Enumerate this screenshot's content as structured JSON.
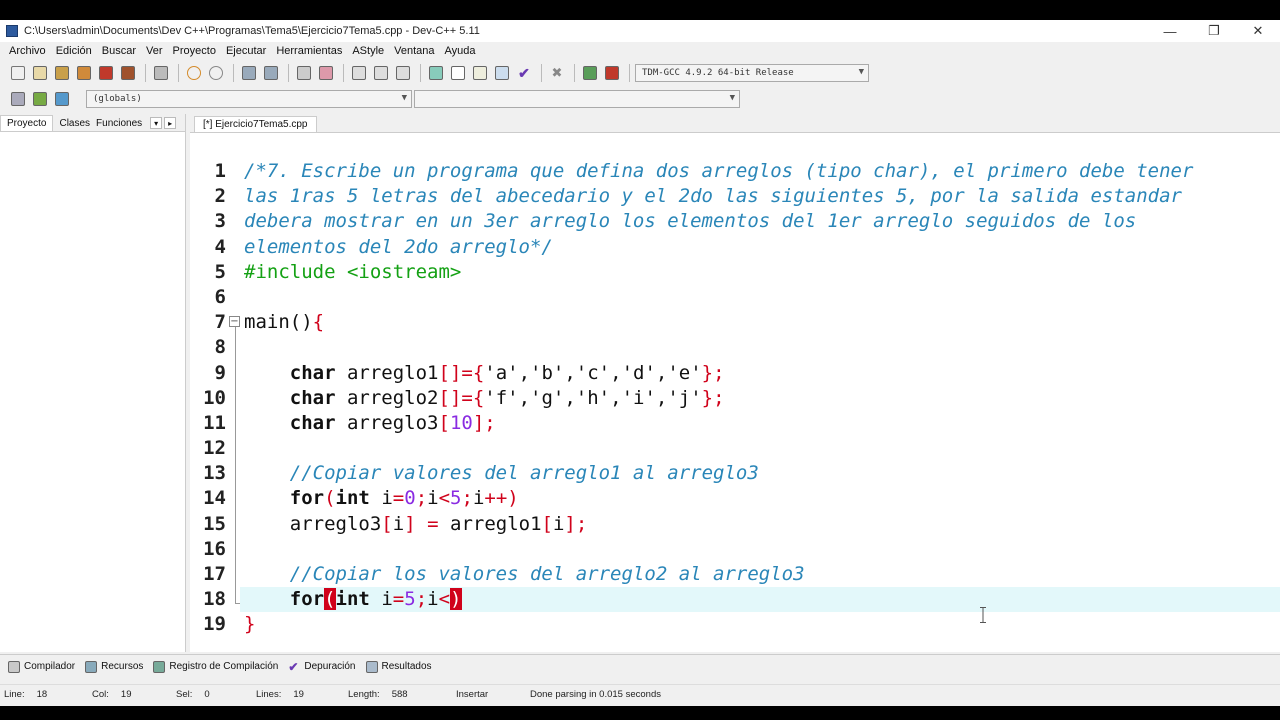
{
  "window": {
    "title": "C:\\Users\\admin\\Documents\\Dev C++\\Programas\\Tema5\\Ejercicio7Tema5.cpp - Dev-C++ 5.11",
    "controls": [
      "—",
      "❐",
      "✕"
    ]
  },
  "menu": [
    "Archivo",
    "Edición",
    "Buscar",
    "Ver",
    "Proyecto",
    "Ejecutar",
    "Herramientas",
    "AStyle",
    "Ventana",
    "Ayuda"
  ],
  "toolbar": {
    "compiler_select": "TDM-GCC 4.9.2 64-bit Release",
    "scope_select": "(globals)",
    "member_select": ""
  },
  "left_panel": {
    "tabs": [
      "Proyecto",
      "Clases",
      "Funciones"
    ],
    "controls": [
      "▾",
      "▸"
    ]
  },
  "editor": {
    "tab_label": "[*] Ejercicio7Tema5.cpp"
  },
  "code": {
    "line_numbers": [
      "1",
      "2",
      "3",
      "4",
      "5",
      "6",
      "7",
      "8",
      "9",
      "10",
      "11",
      "12",
      "13",
      "14",
      "15",
      "16",
      "17",
      "18",
      "19"
    ],
    "line1": "/*7. Escribe un programa que defina dos arreglos (tipo char), el primero debe tener",
    "line2": "las 1ras 5 letras del abecedario y el 2do las siguientes 5, por la salida estandar",
    "line3": "debera mostrar en un 3er arreglo los elementos del 1er arreglo seguidos de los",
    "line4": "elementos del 2do arreglo*/",
    "line5": "#include <iostream>",
    "line7_name": "main()",
    "line7_brace": "{",
    "kw_char": "char",
    "arreglo1": "arreglo1",
    "arreglo2": "arreglo2",
    "arreglo3": "arreglo3",
    "line9_init": "'a','b','c','d','e'",
    "line10_init": "'f','g','h','i','j'",
    "line11_size": "10",
    "line13": "//Copiar valores del arreglo1 al arreglo3",
    "line14_for": "for",
    "line14_int": "int",
    "line14_rest": "i",
    "line17": "//Copiar los valores del arreglo2 al arreglo3",
    "line18_init": "5",
    "line19": "}"
  },
  "bottom_tabs": [
    "Compilador",
    "Recursos",
    "Registro de Compilación",
    "Depuración",
    "Resultados"
  ],
  "status": {
    "line_label": "Line:",
    "line": "18",
    "col_label": "Col:",
    "col": "19",
    "sel_label": "Sel:",
    "sel": "0",
    "lines_label": "Lines:",
    "lines": "19",
    "length_label": "Length:",
    "length": "588",
    "mode": "Insertar",
    "message": "Done parsing in 0.015 seconds"
  }
}
